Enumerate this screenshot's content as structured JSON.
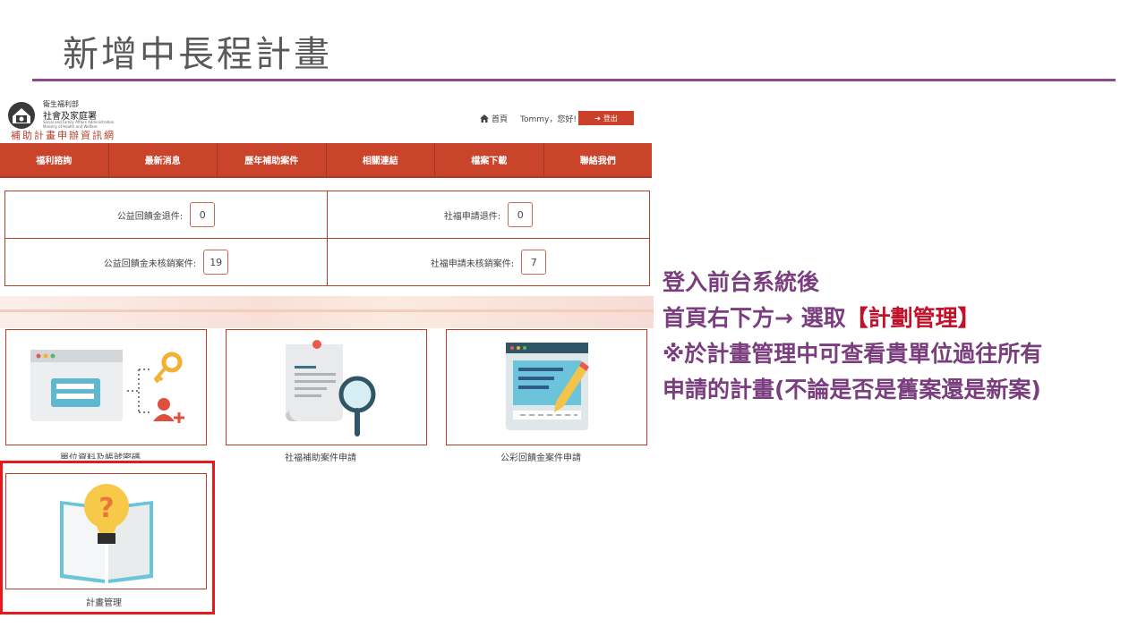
{
  "slide": {
    "title": "新增中長程計畫",
    "note_line1": "登入前台系統後",
    "note_line2_prefix": "首頁右下方→  選取",
    "note_line2_highlight": "【計劃管理】",
    "note_line3": "※於計畫管理中可查看貴單位過往所有",
    "note_line4": "申請的計畫(不論是否是舊案還是新案)",
    "accent_color": "#8e4a8c",
    "highlight_color": "#e8191c"
  },
  "site": {
    "logo_line1": "衛生福利部",
    "logo_line2": "社會及家庭署",
    "logo_line3": "Social and Family Affairs Administration",
    "logo_line4": "Ministry of Health and Welfare",
    "site_name": "補助計畫申辦資訊網",
    "home_label": "首頁",
    "greeting": "Tommy，您好!",
    "logout_label": "登出",
    "brand_color": "#c9442b"
  },
  "nav": {
    "items": [
      {
        "label": "福利諮詢"
      },
      {
        "label": "最新消息"
      },
      {
        "label": "歷年補助案件"
      },
      {
        "label": "相關連結"
      },
      {
        "label": "檔案下載"
      },
      {
        "label": "聯絡我們"
      }
    ]
  },
  "stats": {
    "items": [
      {
        "label": "公益回饋金退件:",
        "value": "0"
      },
      {
        "label": "社福申請退件:",
        "value": "0"
      },
      {
        "label": "公益回饋金未核銷案件:",
        "value": "19"
      },
      {
        "label": "社福申請未核銷案件:",
        "value": "7"
      }
    ]
  },
  "cards": {
    "items": [
      {
        "label": "單位資料及帳號密碼",
        "icon": "login-account-icon"
      },
      {
        "label": "社福補助案件申請",
        "icon": "document-search-icon"
      },
      {
        "label": "公彩回饋金案件申請",
        "icon": "form-edit-icon"
      },
      {
        "label": "計畫管理",
        "icon": "book-lightbulb-question-icon"
      }
    ]
  }
}
